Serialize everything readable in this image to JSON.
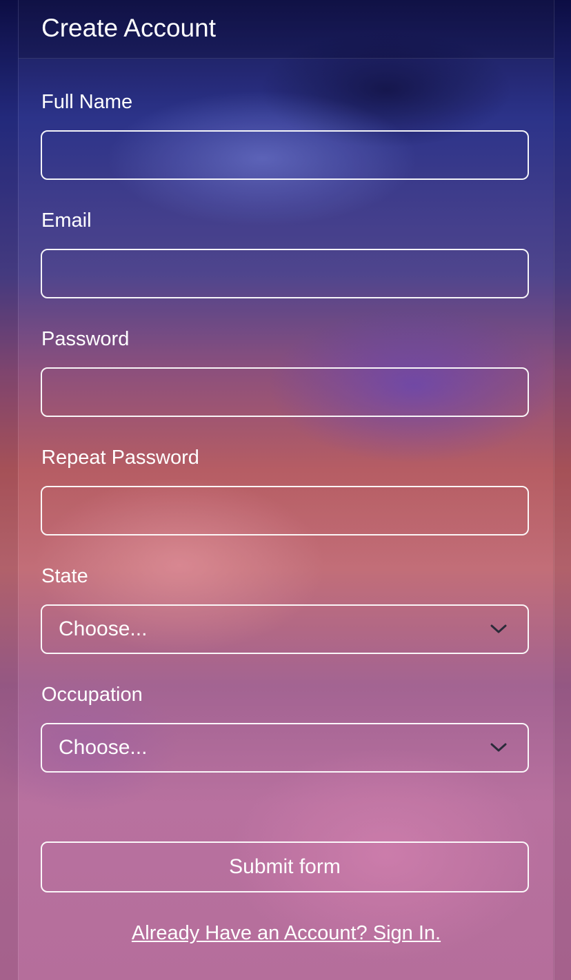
{
  "form": {
    "title": "Create Account",
    "fields": [
      {
        "label": "Full Name",
        "value": ""
      },
      {
        "label": "Email",
        "value": ""
      },
      {
        "label": "Password",
        "value": ""
      },
      {
        "label": "Repeat Password",
        "value": ""
      }
    ],
    "selects": [
      {
        "label": "State",
        "selected": "Choose..."
      },
      {
        "label": "Occupation",
        "selected": "Choose..."
      }
    ],
    "submit_label": "Submit form",
    "signin_link": "Already Have an Account? Sign In."
  },
  "icons": {
    "select_indicator": "chevron-down-icon"
  },
  "colors": {
    "text": "#ffffff",
    "border": "#ffffff",
    "background_top": "#0e0f4a",
    "background_bottom": "#b36a98"
  }
}
